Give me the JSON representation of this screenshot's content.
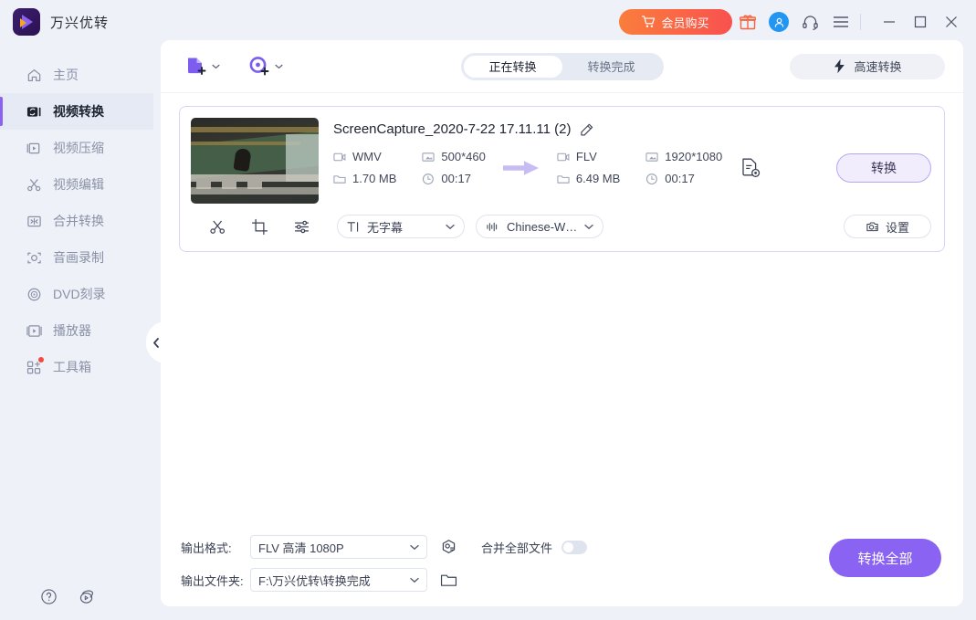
{
  "app": {
    "title": "万兴优转",
    "logo_icon": "play-logo-icon"
  },
  "titlebar": {
    "buy_label": "会员购买",
    "buy_color": "#f9614a",
    "icons": [
      {
        "name": "cart-icon"
      },
      {
        "name": "gift-icon"
      },
      {
        "name": "user-avatar-icon"
      },
      {
        "name": "headset-support-icon"
      },
      {
        "name": "hamburger-menu-icon"
      }
    ],
    "window": {
      "minimize": "minimize-icon",
      "maximize": "maximize-icon",
      "close": "close-icon"
    }
  },
  "sidebar": {
    "items": [
      {
        "label": "主页",
        "icon": "home-icon",
        "active": false,
        "badge": false
      },
      {
        "label": "视频转换",
        "icon": "convert-icon",
        "active": true,
        "badge": false
      },
      {
        "label": "视频压缩",
        "icon": "compress-icon",
        "active": false,
        "badge": false
      },
      {
        "label": "视频编辑",
        "icon": "scissors-icon",
        "active": false,
        "badge": false
      },
      {
        "label": "合并转换",
        "icon": "merge-icon",
        "active": false,
        "badge": false
      },
      {
        "label": "音画录制",
        "icon": "record-icon",
        "active": false,
        "badge": false
      },
      {
        "label": "DVD刻录",
        "icon": "disc-icon",
        "active": false,
        "badge": false
      },
      {
        "label": "播放器",
        "icon": "player-icon",
        "active": false,
        "badge": false
      },
      {
        "label": "工具箱",
        "icon": "toolbox-icon",
        "active": false,
        "badge": true
      }
    ],
    "bottom_icons": [
      {
        "name": "help-question-icon"
      },
      {
        "name": "feedback-icon"
      }
    ],
    "collapse_icon": "chevron-left-icon",
    "accent_color": "#8a63f2"
  },
  "toolbar": {
    "add_file_icon": "add-file-icon",
    "add_disc_icon": "add-disc-icon",
    "dropdown_icon": "chevron-down-icon",
    "tabs": [
      {
        "label": "正在转换",
        "active": true
      },
      {
        "label": "转换完成",
        "active": false
      }
    ],
    "speed_label": "高速转换",
    "speed_icon": "lightning-bolt-icon"
  },
  "file_card": {
    "thumbnail_icon": "video-thumbnail",
    "title": "ScreenCapture_2020-7-22 17.11.11 (2)",
    "edit_icon": "edit-pencil-icon",
    "source": {
      "format": "WMV",
      "resolution": "500*460",
      "size": "1.70 MB",
      "duration": "00:17",
      "format_icon": "video-file-icon",
      "resolution_icon": "resolution-icon",
      "size_icon": "folder-icon",
      "duration_icon": "clock-icon"
    },
    "arrow_icon": "arrow-right-icon",
    "target": {
      "format": "FLV",
      "resolution": "1920*1080",
      "size": "6.49 MB",
      "duration": "00:17",
      "format_icon": "video-file-icon",
      "resolution_icon": "resolution-icon",
      "size_icon": "folder-icon",
      "duration_icon": "clock-icon"
    },
    "file_settings_icon": "file-gear-icon",
    "convert_label": "转换",
    "tools": [
      {
        "name": "trim-scissors-icon"
      },
      {
        "name": "crop-icon"
      },
      {
        "name": "effects-sliders-icon"
      }
    ],
    "subtitle_select": {
      "value": "无字幕",
      "icon": "subtitle-text-icon"
    },
    "audio_select": {
      "value": "Chinese-Win...",
      "icon": "audio-wave-icon"
    },
    "settings_label": "设置",
    "settings_icon": "camera-settings-icon"
  },
  "bottom_bar": {
    "output_format_label": "输出格式:",
    "output_format_value": "FLV 高清 1080P",
    "format_gear_icon": "format-settings-icon",
    "merge_label": "合并全部文件",
    "merge_enabled": false,
    "output_folder_label": "输出文件夹:",
    "output_folder_value": "F:\\万兴优转\\转换完成",
    "folder_icon": "open-folder-icon",
    "convert_all_label": "转换全部",
    "convert_all_color": "#8a63f2"
  }
}
